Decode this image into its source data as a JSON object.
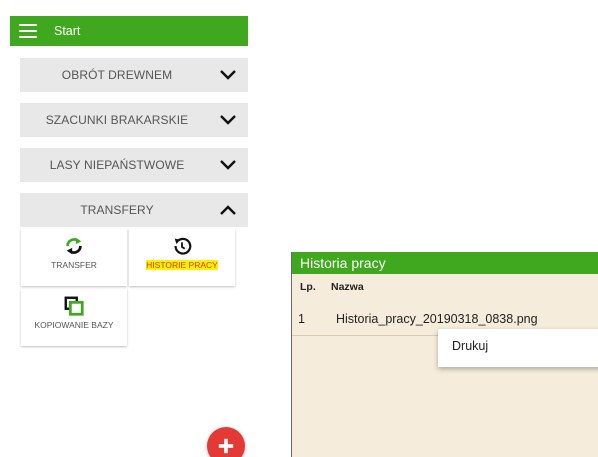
{
  "app_bar": {
    "title": "Start"
  },
  "sections": [
    {
      "label": "OBRÓT DREWNEM",
      "expanded": false
    },
    {
      "label": "SZACUNKI BRAKARSKIE",
      "expanded": false
    },
    {
      "label": "LASY NIEPAŃSTWOWE",
      "expanded": false
    },
    {
      "label": "TRANSFERY",
      "expanded": true
    }
  ],
  "tiles": [
    {
      "label": "TRANSFER",
      "icon": "sync-icon"
    },
    {
      "label": "HISTORIE PRACY",
      "icon": "history-icon",
      "highlighted": true
    },
    {
      "label": "KOPIOWANIE BAZY",
      "icon": "copy-icon"
    }
  ],
  "fab": {
    "icon": "plus-icon"
  },
  "history": {
    "title": "Historia pracy",
    "columns": {
      "lp": "Lp.",
      "name": "Nazwa"
    },
    "rows": [
      {
        "lp": "1",
        "name": "Historia_pracy_20190318_0838.png"
      }
    ],
    "context_menu": {
      "print": "Drukuj"
    }
  },
  "colors": {
    "brand_green": "#3fa81f",
    "fab_red": "#e53935",
    "highlight_yellow": "#fff200",
    "dialog_bg": "#f6ecdb"
  }
}
